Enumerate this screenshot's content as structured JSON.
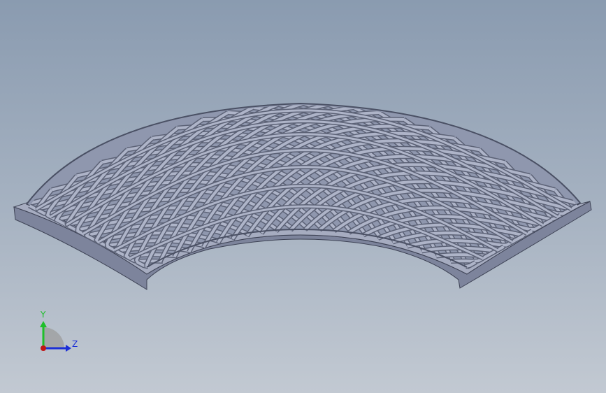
{
  "viewport": {
    "model": "lattice-dome-shell",
    "background_gradient": [
      "#8a9bb0",
      "#a7b3c2",
      "#c2c9d2"
    ],
    "colors": {
      "shell_fill": "#959cb4",
      "shell_face_light": "#b3b9cd",
      "lattice_stroke": "#5c6276",
      "lattice_face": "#aeb4c8",
      "edge_dark": "#3d4254"
    }
  },
  "triad": {
    "y_label": "Y",
    "z_label": "Z",
    "y_color": "#1fbf2a",
    "z_color": "#1c2fd6",
    "x_color": "#c01515"
  }
}
